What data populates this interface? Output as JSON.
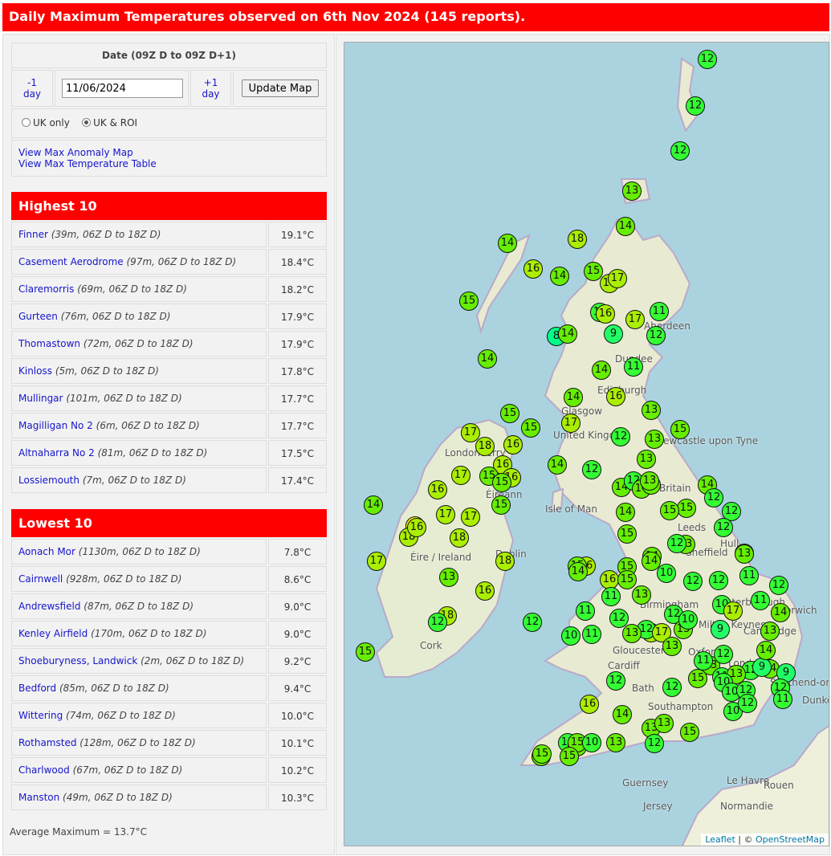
{
  "title": "Daily Maximum Temperatures observed on 6th Nov 2024 (145 reports).",
  "controls": {
    "date_header": "Date (09Z D to 09Z D+1)",
    "prev_day": "-1 day",
    "next_day": "+1 day",
    "date_value": "11/06/2024",
    "update_label": "Update Map",
    "region_uk_only": "UK only",
    "region_uk_roi": "UK & ROI",
    "region_selected": "UK & ROI",
    "link_anomaly": "View Max Anomaly Map",
    "link_table": "View Max Temperature Table"
  },
  "highest": {
    "heading": "Highest 10",
    "rows": [
      {
        "name": "Finner",
        "detail": "(39m, 06Z D to 18Z D)",
        "value": "19.1°C"
      },
      {
        "name": "Casement Aerodrome",
        "detail": "(97m, 06Z D to 18Z D)",
        "value": "18.4°C"
      },
      {
        "name": "Claremorris",
        "detail": "(69m, 06Z D to 18Z D)",
        "value": "18.2°C"
      },
      {
        "name": "Gurteen",
        "detail": "(76m, 06Z D to 18Z D)",
        "value": "17.9°C"
      },
      {
        "name": "Thomastown",
        "detail": "(72m, 06Z D to 18Z D)",
        "value": "17.9°C"
      },
      {
        "name": "Kinloss",
        "detail": "(5m, 06Z D to 18Z D)",
        "value": "17.8°C"
      },
      {
        "name": "Mullingar",
        "detail": "(101m, 06Z D to 18Z D)",
        "value": "17.7°C"
      },
      {
        "name": "Magilligan No 2",
        "detail": "(6m, 06Z D to 18Z D)",
        "value": "17.7°C"
      },
      {
        "name": "Altnaharra No 2",
        "detail": "(81m, 06Z D to 18Z D)",
        "value": "17.5°C"
      },
      {
        "name": "Lossiemouth",
        "detail": "(7m, 06Z D to 18Z D)",
        "value": "17.4°C"
      }
    ]
  },
  "lowest": {
    "heading": "Lowest 10",
    "rows": [
      {
        "name": "Aonach Mor",
        "detail": "(1130m, 06Z D to 18Z D)",
        "value": "7.8°C"
      },
      {
        "name": "Cairnwell",
        "detail": "(928m, 06Z D to 18Z D)",
        "value": "8.6°C"
      },
      {
        "name": "Andrewsfield",
        "detail": "(87m, 06Z D to 18Z D)",
        "value": "9.0°C"
      },
      {
        "name": "Kenley Airfield",
        "detail": "(170m, 06Z D to 18Z D)",
        "value": "9.0°C"
      },
      {
        "name": "Shoeburyness, Landwick",
        "detail": "(2m, 06Z D to 18Z D)",
        "value": "9.2°C"
      },
      {
        "name": "Bedford",
        "detail": "(85m, 06Z D to 18Z D)",
        "value": "9.4°C"
      },
      {
        "name": "Wittering",
        "detail": "(74m, 06Z D to 18Z D)",
        "value": "10.0°C"
      },
      {
        "name": "Rothamsted",
        "detail": "(128m, 06Z D to 18Z D)",
        "value": "10.1°C"
      },
      {
        "name": "Charlwood",
        "detail": "(67m, 06Z D to 18Z D)",
        "value": "10.2°C"
      },
      {
        "name": "Manston",
        "detail": "(49m, 06Z D to 18Z D)",
        "value": "10.3°C"
      }
    ]
  },
  "average": "Average Maximum = 13.7°C",
  "map": {
    "attribution_leaflet": "Leaflet",
    "attribution_sep": " | © ",
    "attribution_osm": "OpenStreetMap",
    "place_labels": [
      "Aberdeen",
      "Dundee",
      "Edinburgh",
      "Glasgow",
      "United Kingdom",
      "Newcastle upon Tyne",
      "Britain",
      "Isle of Man",
      "Leeds",
      "Hull",
      "Sheffield",
      "Birmingham",
      "Peterborough",
      "Cambridge",
      "Norwich",
      "Gloucester",
      "Cardiff",
      "Bath",
      "London",
      "Southend-on-Sea",
      "Dunkerque",
      "Guernsey",
      "Jersey",
      "Le Havre",
      "Rouen",
      "Normandie",
      "Londonderry",
      "Éire / Ireland",
      "Dublin",
      "Cork",
      "Milton Keynes",
      "Oxford",
      "Southampton",
      "Éireann"
    ],
    "temp_colors": {
      "7.8": "#00ff88",
      "10": "#33ff33",
      "14": "#66ee00",
      "17": "#aaee00",
      "19": "#ffee00"
    },
    "markers": [
      12,
      12,
      12,
      13,
      14,
      14,
      18,
      16,
      14,
      15,
      18,
      17,
      15,
      17,
      11,
      11,
      16,
      8,
      14,
      9,
      12,
      14,
      11,
      14,
      14,
      16,
      15,
      13,
      15,
      17,
      17,
      18,
      16,
      12,
      13,
      15,
      13,
      12,
      14,
      16,
      15,
      16,
      15,
      17,
      17,
      14,
      12,
      14,
      14,
      13,
      16,
      19,
      18,
      15,
      14,
      12,
      15,
      17,
      14,
      15,
      18,
      18,
      14,
      16,
      17,
      13,
      12,
      12,
      14,
      13,
      15,
      13,
      12,
      16,
      15,
      14,
      15,
      13,
      16,
      10,
      15,
      14,
      12,
      12,
      11,
      13,
      16,
      11,
      10,
      12,
      12,
      13,
      11,
      17,
      18,
      12,
      10,
      11,
      14,
      12,
      16,
      12,
      12,
      9,
      13,
      13,
      11,
      17,
      14,
      15,
      13,
      12,
      9,
      11,
      13,
      13,
      12,
      14,
      10,
      11,
      10,
      12,
      15,
      9,
      10,
      12,
      11,
      10,
      12,
      12,
      16,
      14,
      13,
      12,
      13,
      11,
      14,
      15,
      13,
      15,
      15,
      15,
      10,
      12,
      15
    ]
  }
}
